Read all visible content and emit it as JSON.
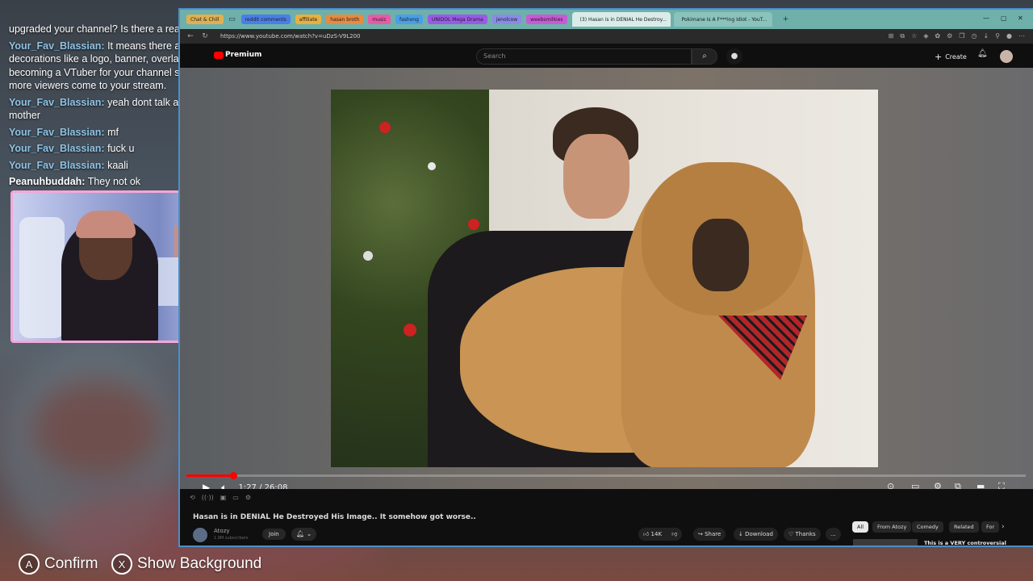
{
  "chat": {
    "messages": [
      {
        "user": "",
        "text": "upgraded your channel? Is there a reason?"
      },
      {
        "user": "Your_Fav_Blassian:",
        "text": "It means there are no decorations like a logo, banner, overlay, or becoming a VTuber for your channel so that more viewers come to your stream."
      },
      {
        "user": "Your_Fav_Blassian:",
        "text": "yeah dont talk about my mother"
      },
      {
        "user": "Your_Fav_Blassian:",
        "text": "mf"
      },
      {
        "user": "Your_Fav_Blassian:",
        "text": "fuck u"
      },
      {
        "user": "Your_Fav_Blassian:",
        "text": "kaali"
      },
      {
        "user": "Peanuhbuddah:",
        "text": "They not ok"
      }
    ]
  },
  "hints": {
    "confirm_glyph": "A",
    "confirm_label": "Confirm",
    "background_glyph": "X",
    "background_label": "Show Background"
  },
  "browser": {
    "tab_group_label": "Chat & Chill",
    "groups": [
      {
        "label": "reddit comments",
        "color": "#4a7ee8"
      },
      {
        "label": "affiliate",
        "color": "#e8b040"
      },
      {
        "label": "hasan broth",
        "color": "#e88a40"
      },
      {
        "label": "music",
        "color": "#e85aa8"
      },
      {
        "label": "fashong",
        "color": "#4a9ee8"
      },
      {
        "label": "UNIDOL Mega Drama",
        "color": "#9a5ae8"
      },
      {
        "label": "jenolcow",
        "color": "#8a8ae8"
      },
      {
        "label": "weebsmilkies",
        "color": "#c85ad8"
      }
    ],
    "tabs": [
      {
        "title": "(3) Hasan is in DENIAL He Destroy...",
        "active": true
      },
      {
        "title": "Pokimane Is A F***ing Idiot - YouT...",
        "active": false
      }
    ],
    "url": "https://www.youtube.com/watch?v=uDzS-V9L200"
  },
  "youtube": {
    "logo_text": "Premium",
    "search_placeholder": "Search",
    "create_label": "Create",
    "time": "1:27 / 26:08",
    "progress_fraction": 0.056,
    "video_title": "Hasan is in DENIAL He Destroyed His Image.. It somehow got worse..",
    "channel_name": "Atozy",
    "channel_subs": "1.9M subscribers",
    "join_label": "Join",
    "likes": "14K",
    "share_label": "Share",
    "download_label": "Download",
    "thanks_label": "Thanks",
    "more_label": "...",
    "chips": [
      "All",
      "From Atozy",
      "Comedy",
      "Related",
      "For"
    ],
    "rec_title": "This is a VERY controversial"
  }
}
